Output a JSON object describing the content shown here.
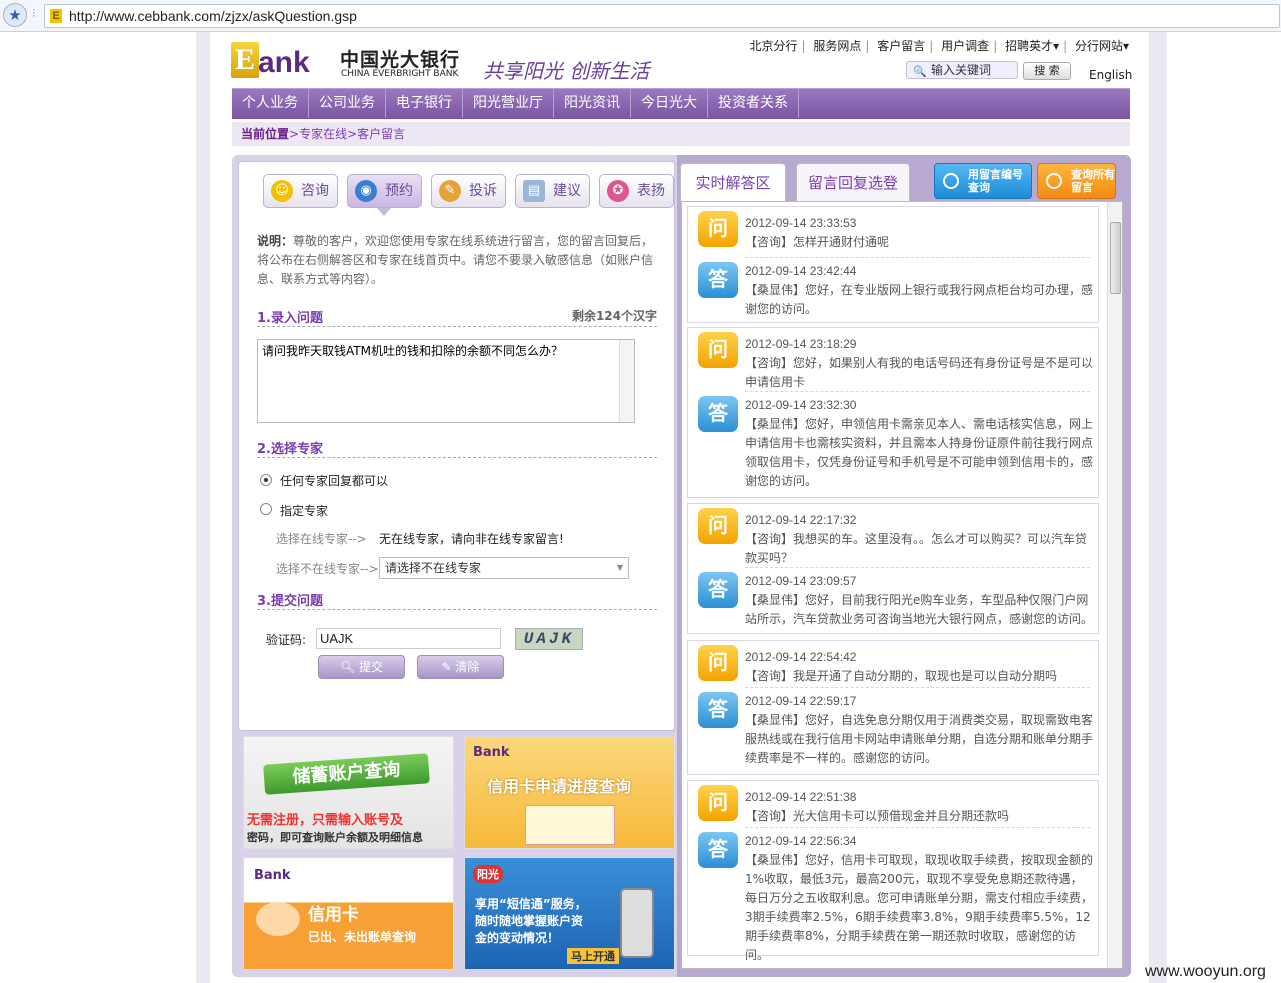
{
  "browser": {
    "url": "http://www.cebbank.com/zjzx/askQuestion.gsp"
  },
  "header": {
    "logo_e": "E",
    "logo_ank": "ank",
    "bank_cn": "中国光大银行",
    "bank_en": "CHINA EVERBRIGHT BANK",
    "slogan": "共享阳光 创新生活",
    "toplinks": [
      "北京分行",
      "服务网点",
      "客户留言",
      "用户调查",
      "招聘英才▾",
      "分行网站▾"
    ],
    "search_placeholder": "输入关键词",
    "search_button": "搜 索",
    "english": "English"
  },
  "nav": [
    "个人业务",
    "公司业务",
    "电子银行",
    "阳光营业厅",
    "阳光资讯",
    "今日光大",
    "投资者关系"
  ],
  "breadcrumb": {
    "label": "当前位置",
    "path": ">专家在线>客户留言"
  },
  "left": {
    "tabs": [
      "咨询",
      "预约",
      "投诉",
      "建议",
      "表扬"
    ],
    "desc_label": "说明：",
    "desc_text": "尊敬的客户，欢迎您使用专家在线系统进行留言，您的留言回复后，将公布在右侧解答区和专家在线首页中。请您不要录入敏感信息（如账户信息、联系方式等内容）。",
    "sec1": "1.录入问题",
    "remain": "剩余124个汉字",
    "question": "请问我昨天取钱ATM机吐的钱和扣除的余额不同怎么办？",
    "sec2": "2.选择专家",
    "opt_any": "任何专家回复都可以",
    "opt_spec": "指定专家",
    "online_label": "选择在线专家-->",
    "online_value": "无在线专家，请向非在线专家留言!",
    "offline_label": "选择不在线专家-->",
    "offline_value": "请选择不在线专家",
    "sec3": "3.提交问题",
    "captcha_label": "验证码:",
    "captcha_value": "UAJK",
    "captcha_img": "UAJK",
    "submit": "提交",
    "clear": "清除"
  },
  "banners": {
    "b1_title": "储蓄账户查询",
    "b1_line1": "无需注册，只需输入账号及",
    "b1_line2": "密码，即可查询账户余额及明细信息",
    "b2_title": "信用卡申请进度查询",
    "b3_title": "信用卡",
    "b3_sub": "已出、未出账单查询",
    "b4_brand": "阳光",
    "b4_line1": "享用“短信通”服务，",
    "b4_line2": "随时随地掌握账户资",
    "b4_line3": "金的变动情况！",
    "b4_btn": "马上开通"
  },
  "right": {
    "tab1": "实时解答区",
    "tab2": "留言回复选登",
    "btn_blue": "用留言编号查询",
    "btn_orange": "查询所有留言",
    "q_mark": "问",
    "a_mark": "答",
    "items": [
      {
        "qtime": "2012-09-14 23:33:53",
        "q": "【咨询】怎样开通财付通呢",
        "atime": "2012-09-14 23:42:44",
        "a": "【桑显伟】您好，在专业版网上银行或我行网点柜台均可办理，感谢您的访问。"
      },
      {
        "qtime": "2012-09-14 23:18:29",
        "q": "【咨询】您好，如果别人有我的电话号码还有身份证号是不是可以申请信用卡",
        "atime": "2012-09-14 23:32:30",
        "a": "【桑显伟】您好，申领信用卡需亲见本人、需电话核实信息，网上申请信用卡也需核实资料，并且需本人持身份证原件前往我行网点领取信用卡，仅凭身份证号和手机号是不可能申领到信用卡的，感谢您的访问。"
      },
      {
        "qtime": "2012-09-14 22:17:32",
        "q": "【咨询】我想买的车。这里没有。。怎么才可以购买？可以汽车贷款买吗？",
        "atime": "2012-09-14 23:09:57",
        "a": "【桑显伟】您好，目前我行阳光e购车业务，车型品种仅限门户网站所示，汽车贷款业务可咨询当地光大银行网点，感谢您的访问。"
      },
      {
        "qtime": "2012-09-14 22:54:42",
        "q": "【咨询】我是开通了自动分期的，取现也是可以自动分期吗",
        "atime": "2012-09-14 22:59:17",
        "a": "【桑显伟】您好，自选免息分期仅用于消费类交易，取现需致电客服热线或在我行信用卡网站申请账单分期，自选分期和账单分期手续费率是不一样的。感谢您的访问。"
      },
      {
        "qtime": "2012-09-14 22:51:38",
        "q": "【咨询】光大信用卡可以预借现金并且分期还款吗",
        "atime": "2012-09-14 22:56:34",
        "a": "【桑显伟】您好，信用卡可取现，取现收取手续费，按取现金额的1%收取，最低3元，最高200元，取现不享受免息期还款待遇，每日万分之五收取利息。您可申请账单分期，需支付相应手续费，3期手续费率2.5%，6期手续费率3.8%，9期手续费率5.5%，12期手续费率8%，分期手续费在第一期还款时收取，感谢您的访问。"
      }
    ]
  },
  "watermark": "www.wooyun.org"
}
